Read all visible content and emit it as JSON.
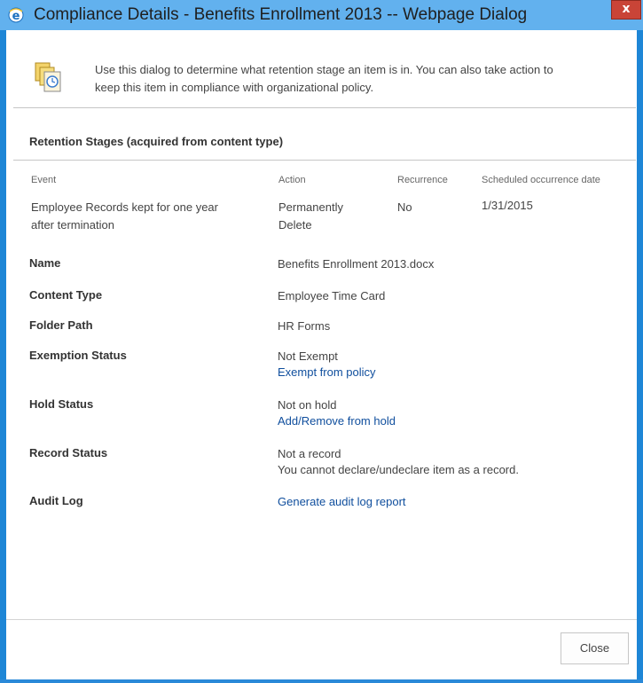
{
  "window": {
    "title": "Compliance Details - Benefits Enrollment 2013 -- Webpage Dialog",
    "close_glyph": "x",
    "icon": "internet-explorer-icon"
  },
  "intro": {
    "icon": "document-clock-icon",
    "text_line1": "Use this dialog to determine what retention stage an item is in. You can also take action to",
    "text_line2": "keep this item in compliance with organizational policy."
  },
  "retention": {
    "title": "Retention Stages (acquired from content type)",
    "columns": [
      "Event",
      "Action",
      "Recurrence",
      "Scheduled occurrence date"
    ],
    "rows": [
      {
        "event_line1": "Employee Records kept for one year",
        "event_line2": "after termination",
        "action_line1": "Permanently",
        "action_line2": "Delete",
        "recurrence": "No",
        "date": "1/31/2015"
      }
    ]
  },
  "details": {
    "name": {
      "label": "Name",
      "value": "Benefits Enrollment 2013.docx"
    },
    "content_type": {
      "label": "Content Type",
      "value": "Employee Time Card"
    },
    "folder_path": {
      "label": "Folder Path",
      "value": "HR Forms"
    },
    "exemption": {
      "label": "Exemption Status",
      "value": "Not Exempt",
      "link": "Exempt from policy"
    },
    "hold": {
      "label": "Hold Status",
      "value": "Not on hold",
      "link": "Add/Remove from hold"
    },
    "record": {
      "label": "Record Status",
      "value": "Not a record",
      "note": "You cannot declare/undeclare item as a record."
    },
    "audit": {
      "label": "Audit Log",
      "link": "Generate audit log report"
    }
  },
  "footer": {
    "close_label": "Close"
  },
  "colors": {
    "title_bar": "#62b1ee",
    "window_frame": "#1e86d6",
    "close_button": "#c94437",
    "link": "#0f4e9d"
  }
}
